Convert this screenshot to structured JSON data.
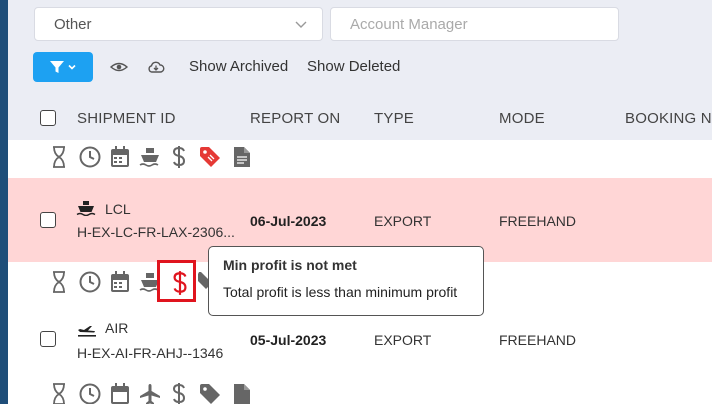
{
  "filters": {
    "other_value": "Other",
    "account_manager_placeholder": "Account Manager"
  },
  "toolbar": {
    "show_archived_label": "Show Archived",
    "show_deleted_label": "Show Deleted"
  },
  "columns": {
    "shipment_id": "SHIPMENT ID",
    "report_on": "REPORT ON",
    "type": "TYPE",
    "mode": "MODE",
    "booking_no": "BOOKING NO"
  },
  "rows": [
    {
      "mode_label": "LCL",
      "mode_icon": "ship-icon",
      "shipment_id": "H-EX-LC-FR-LAX-2306...",
      "report_on": "06-Jul-2023",
      "type": "EXPORT",
      "mode": "FREEHAND",
      "highlighted": true
    },
    {
      "mode_label": "AIR",
      "mode_icon": "plane-icon",
      "shipment_id": "H-EX-AI-FR-AHJ--1346",
      "report_on": "05-Jul-2023",
      "type": "EXPORT",
      "mode": "FREEHAND",
      "highlighted": false
    }
  ],
  "tooltip": {
    "title": "Min profit is not met",
    "body": "Total profit is less than minimum profit"
  },
  "colors": {
    "accent": "#1da1f2",
    "highlight_row": "#ffd6d6",
    "alert_red": "#e0141e",
    "icon_gray": "#666666",
    "tag_red": "#e53935"
  }
}
